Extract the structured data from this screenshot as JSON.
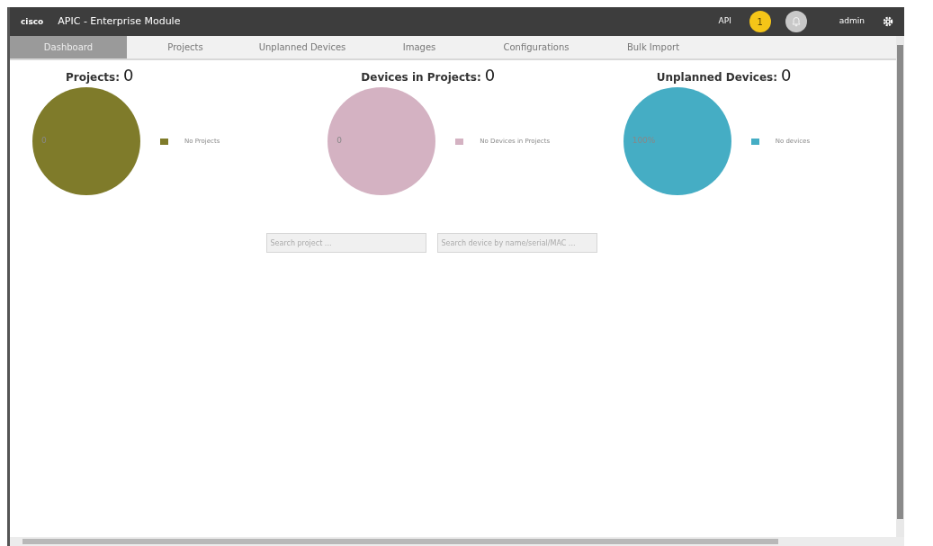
{
  "header": {
    "logo": "cisco",
    "title": "APIC - Enterprise Module",
    "api_link": "API",
    "notification_count": "1",
    "user": "admin"
  },
  "tabs": [
    {
      "label": "Dashboard",
      "selected": true
    },
    {
      "label": "Projects",
      "selected": false
    },
    {
      "label": "Unplanned Devices",
      "selected": false
    },
    {
      "label": "Images",
      "selected": false
    },
    {
      "label": "Configurations",
      "selected": false
    },
    {
      "label": "Bulk Import",
      "selected": false
    }
  ],
  "summaries": [
    {
      "title": "Projects:",
      "count": "0",
      "slice_label": "0",
      "legend": "No Projects",
      "color": "#7f7b2a"
    },
    {
      "title": "Devices in Projects:",
      "count": "0",
      "slice_label": "0",
      "legend": "No Devices in Projects",
      "color": "#d4b2c2"
    },
    {
      "title": "Unplanned Devices:",
      "count": "0",
      "slice_label": "100%",
      "legend": "No devices",
      "color": "#45adc4"
    }
  ],
  "search_fields": [
    {
      "placeholder": "Search project ..."
    },
    {
      "placeholder": "Search device by name/serial/MAC ..."
    }
  ]
}
